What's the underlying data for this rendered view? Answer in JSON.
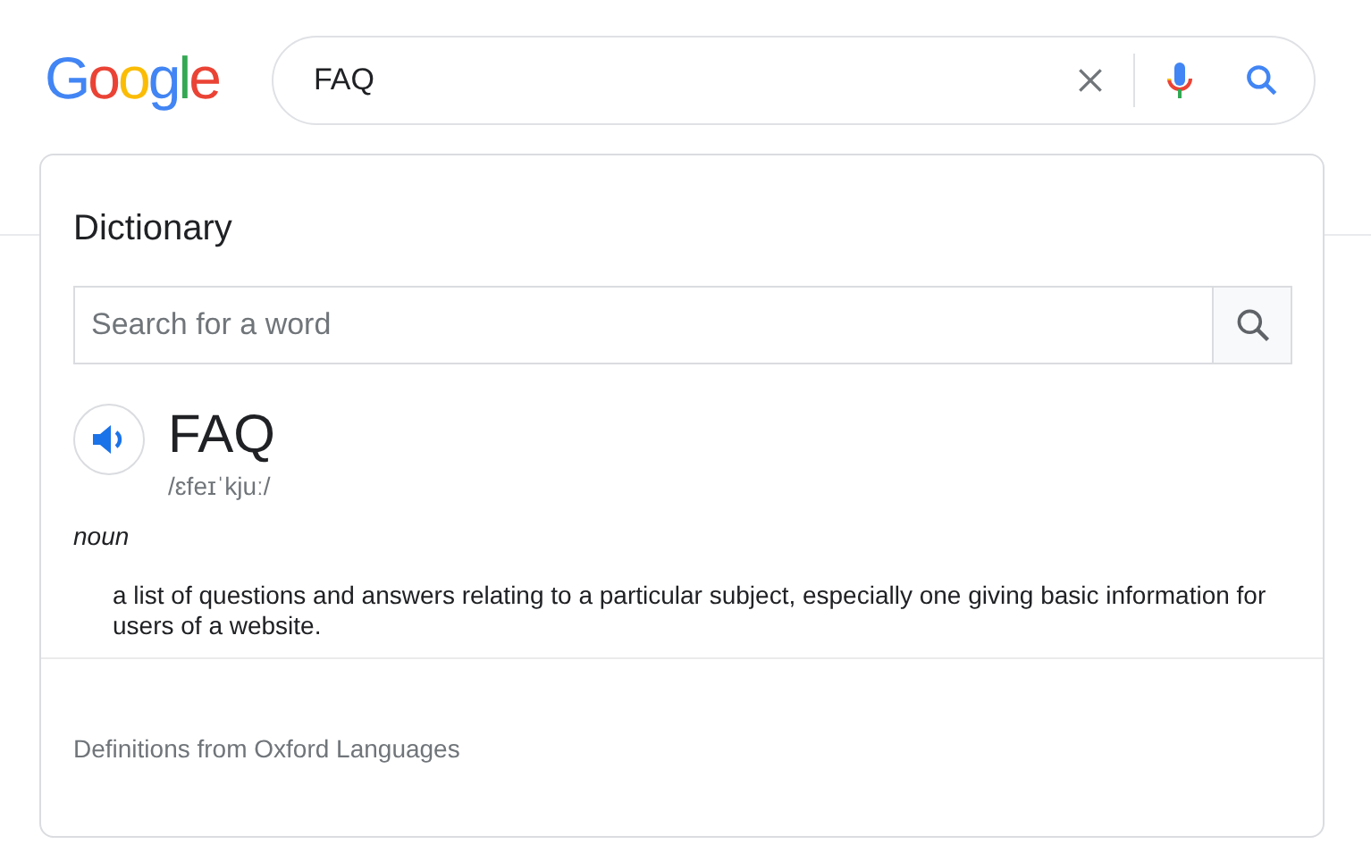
{
  "logo": "Google",
  "search": {
    "value": "FAQ"
  },
  "dictionary": {
    "title": "Dictionary",
    "search_placeholder": "Search for a word",
    "word": "FAQ",
    "phonetic": "/ɛfeɪˈkjuː/",
    "part_of_speech": "noun",
    "definitions": [
      "a list of questions and answers relating to a particular subject, especially one giving basic information for users of a website."
    ],
    "source": "Definitions from Oxford Languages"
  }
}
